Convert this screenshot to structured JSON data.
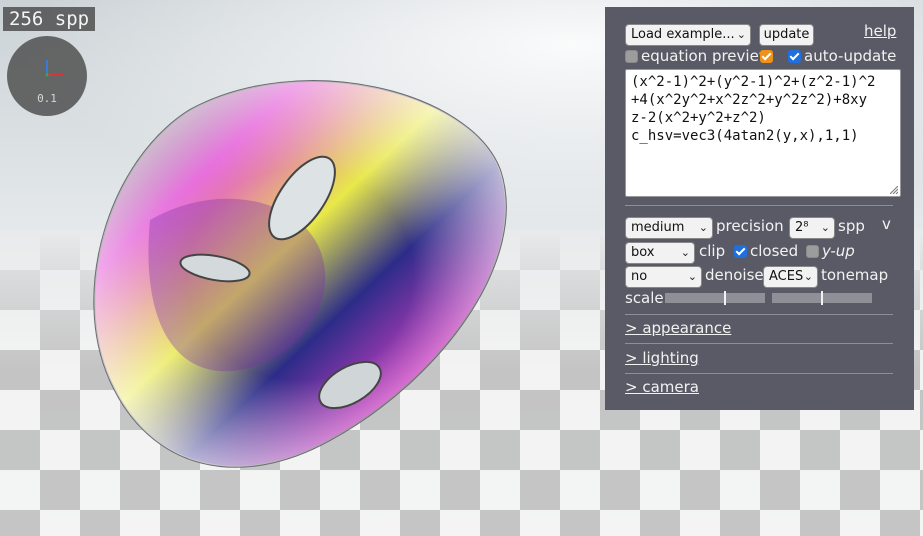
{
  "viewport": {
    "spp_counter": "256 spp",
    "gizmo_scale": "0.1"
  },
  "panel": {
    "example_select": "Load example...",
    "update_button": "update",
    "help_link": "help",
    "equation_preview_label": "equation preview",
    "equation_preview_checked": false,
    "equation_preview_toggle_checked": true,
    "auto_update_label": "auto-update",
    "auto_update_checked": true,
    "equation_lines": [
      "(x^2-1)^2+(y^2-1)^2+(z^2-1)^2",
      "+4(x^2y^2+x^2z^2+y^2z^2)+8xy",
      "z-2(x^2+y^2+z^2)",
      "c_hsv=vec3(4atan2(y,x),1,1)"
    ],
    "precision_select": "medium",
    "precision_label": "precision",
    "spp_select": "2⁸",
    "spp_label": "spp",
    "collapse_toggle": "v",
    "clip_select": "box",
    "clip_label": "clip",
    "closed_label": "closed",
    "closed_checked": true,
    "yup_label": "y-up",
    "yup_checked": false,
    "denoise_select": "no",
    "denoise_label": "denoise",
    "tonemap_select": "ACES",
    "tonemap_label": "tonemap",
    "scale_label": "scale",
    "scale_slider_1": 0.6,
    "scale_slider_2": 0.5,
    "sections": [
      "> appearance",
      "> lighting",
      "> camera"
    ]
  },
  "colors": {
    "panel_bg": "#5a5a66",
    "checkbox_blue": "#1e6fe0",
    "checkbox_orange": "#f09218"
  }
}
